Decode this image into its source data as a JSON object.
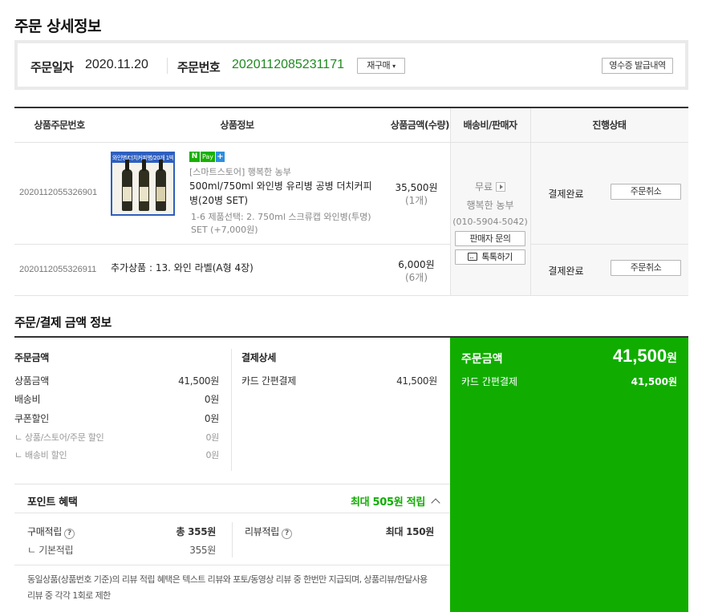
{
  "page": {
    "title": "주문 상세정보"
  },
  "summary": {
    "date_label": "주문일자",
    "date_value": "2020.11.20",
    "order_label": "주문번호",
    "order_value": "2020112085231171",
    "reorder_label": "재구매",
    "receipt_label": "영수증 발급내역"
  },
  "table": {
    "headers": [
      "상품주문번호",
      "상품정보",
      "상품금액(수량)",
      "배송비/판매자",
      "진행상태"
    ],
    "rows": [
      {
        "order_no": "2020112055326901",
        "thumb_text": "와인병/더치커피병/20개 1박스",
        "badge_n": "N",
        "badge_pay": "Pay",
        "badge_plus": "+",
        "store": "[스마트스토어] 행복한 농부",
        "name_line1": "500ml/750ml 와인병 유리병 공병 더치커피",
        "name_line2": "병(20병 SET)",
        "option_line1": "1-6 제품선택: 2. 750ml 스크류캡 와인병(투명)",
        "option_line2": "SET (+7,000원)",
        "price": "35,500원",
        "qty": "(1개)",
        "status": "결제완료",
        "cancel_label": "주문취소"
      },
      {
        "order_no": "2020112055326911",
        "name_line1": "추가상품 : 13. 와인 라벨(A형 4장)",
        "price": "6,000원",
        "qty": "(6개)",
        "status": "결제완료",
        "cancel_label": "주문취소"
      }
    ],
    "shipping": {
      "fee": "무료",
      "seller": "행복한 농부",
      "phone": "(010-5904-5042)",
      "inquiry_label": "판매자 문의",
      "talk_label": "톡톡하기"
    }
  },
  "payment": {
    "section_title": "주문/결제 금액 정보",
    "order_amount": {
      "title": "주문금액",
      "items": [
        {
          "label": "상품금액",
          "value": "41,500원"
        },
        {
          "label": "배송비",
          "value": "0원"
        },
        {
          "label": "쿠폰할인",
          "value": "0원"
        },
        {
          "label": "ㄴ 상품/스토어/주문 할인",
          "value": "0원"
        },
        {
          "label": "ㄴ 배송비 할인",
          "value": "0원"
        }
      ]
    },
    "payment_detail": {
      "title": "결제상세",
      "items": [
        {
          "label": "카드 간편결제",
          "value": "41,500원"
        }
      ]
    },
    "total": {
      "label": "주문금액",
      "amount": "41,500",
      "unit": "원",
      "method_label": "카드 간편결제",
      "method_value": "41,500원"
    },
    "points": {
      "title": "포인트 혜택",
      "max_label": "최대 505원 적립",
      "purchase_label": "구매적립",
      "purchase_value": "총 355원",
      "basic_label": "ㄴ 기본적립",
      "basic_value": "355원",
      "review_label": "리뷰적립",
      "review_value": "최대 150원",
      "note_line1": "동일상품(상품번호 기준)의 리뷰 적립 혜택은 텍스트 리뷰와 포토/동영상 리뷰 중 한번만 지급되며, 상품리뷰/한달사용",
      "note_line2": "리뷰 중 각각 1회로 제한"
    }
  },
  "colors": {
    "accent_green": "#10ad00",
    "order_no_green": "#1e8a1e",
    "npay_green": "#19b000"
  }
}
